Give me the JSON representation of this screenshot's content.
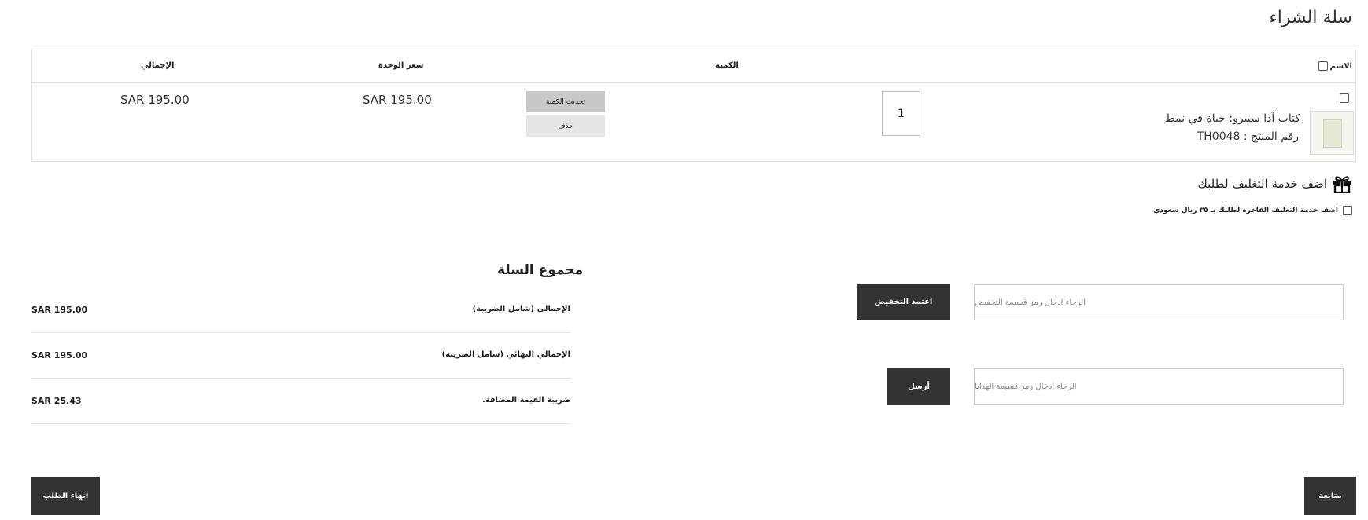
{
  "page": {
    "title": "سلة الشراء"
  },
  "table": {
    "headers": {
      "name": "الاسم",
      "quantity": "الكمية",
      "unit_price": "سعر الوحدة",
      "total": "الإجمالي"
    },
    "row": {
      "product_name": "كتاب آدا سبيرو: حياة في نمط",
      "sku_label": "رقم المنتج :",
      "sku": "TH0048",
      "quantity": "1",
      "update_label": "تحديث الكمية",
      "delete_label": "حذف",
      "unit_price": "SAR 195.00",
      "total": "SAR 195.00"
    }
  },
  "gift_wrap": {
    "title": "اضف خدمة التغليف لطلبك",
    "option": "اضف خدمة التغليف الفاخره لطلبك بـ ٣٥ ريال سعودي"
  },
  "coupon": {
    "placeholder": "الرجاء ادخال رمز قسيمة التخفيض",
    "button": "اعتمد التخفيض"
  },
  "gift_card": {
    "placeholder": "الرجاء ادخال رمز قسيمة الهدايا",
    "button": "أرسل"
  },
  "totals": {
    "title": "مجموع السلة",
    "rows": [
      {
        "label": "الإجمالي (شامل الضريبة)",
        "value": "SAR 195.00"
      },
      {
        "label": "الإجمالي النهائي (شامل الضريبة)",
        "value": "SAR 195.00"
      },
      {
        "label": "ضريبة القيمة المضافة.",
        "value": "SAR 25.43"
      }
    ]
  },
  "actions": {
    "finish": "انهاء الطلب",
    "continue": "متابعة"
  },
  "colors": {
    "dark_button": "#333333",
    "update_button": "#c8c8c8",
    "delete_button": "#e6e6e6"
  },
  "icons": {
    "gift": "gift-icon"
  }
}
